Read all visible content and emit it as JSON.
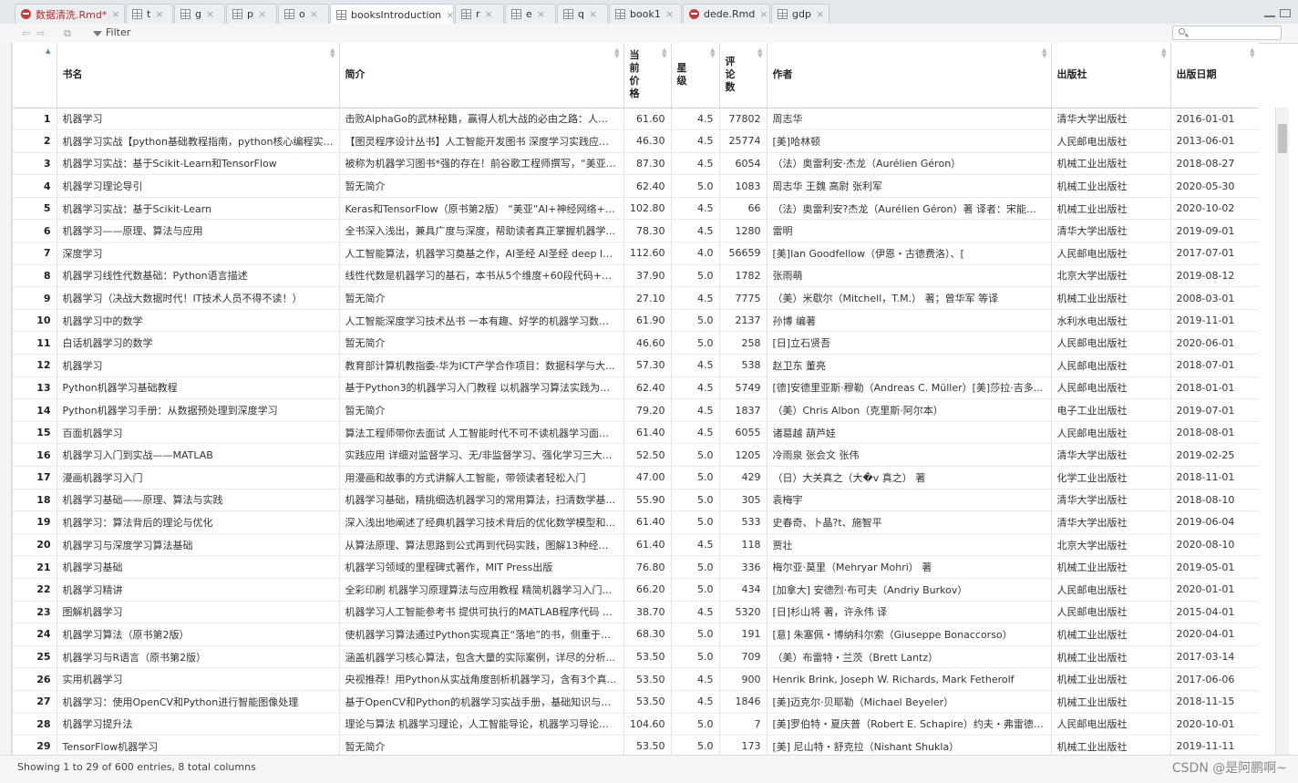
{
  "tabs": [
    {
      "label": "数据清洗.Rmd*",
      "icon": "rmd-icon",
      "modified": true,
      "w": 121
    },
    {
      "label": "t",
      "icon": "table-icon",
      "w": 52
    },
    {
      "label": "g",
      "icon": "table-icon",
      "w": 56
    },
    {
      "label": "p",
      "icon": "table-icon",
      "w": 56
    },
    {
      "label": "o",
      "icon": "table-icon",
      "w": 56
    },
    {
      "label": "booksIntroduction",
      "icon": "table-icon",
      "active": true,
      "w": 136
    },
    {
      "label": "r",
      "icon": "table-icon",
      "w": 54
    },
    {
      "label": "e",
      "icon": "table-icon",
      "w": 56
    },
    {
      "label": "q",
      "icon": "table-icon",
      "w": 56
    },
    {
      "label": "book1",
      "icon": "table-icon",
      "w": 80
    },
    {
      "label": "dede.Rmd",
      "icon": "rmd-icon",
      "w": 96
    },
    {
      "label": "gdp",
      "icon": "table-icon",
      "w": 64
    }
  ],
  "toolbar": {
    "filter_label": "Filter"
  },
  "columns": [
    {
      "label": "",
      "w": 48,
      "cls": "idx"
    },
    {
      "label": "书名",
      "w": 310
    },
    {
      "label": "简介",
      "w": 312
    },
    {
      "label": "当\n前\n价\n格",
      "w": 52,
      "cls": "num"
    },
    {
      "label": "星\n级",
      "w": 53,
      "cls": "num"
    },
    {
      "label": "评\n论\n数",
      "w": 52,
      "cls": "num"
    },
    {
      "label": "作者",
      "w": 312
    },
    {
      "label": "出版社",
      "w": 131
    },
    {
      "label": "出版日期",
      "w": 97
    }
  ],
  "rows": [
    [
      "1",
      "机器学习",
      "击败AlphaGo的武林秘籍，赢得人机大战的必由之路：人工...",
      "61.60",
      "4.5",
      "77802",
      "周志华",
      "清华大学出版社",
      "2016-01-01"
    ],
    [
      "2",
      "机器学习实战【python基础教程指南，python核心编程实例...",
      "【图灵程序设计丛书】人工智能开发图书 深度学习实践应用...",
      "46.30",
      "4.5",
      "25774",
      "[美]哈林顿",
      "人民邮电出版社",
      "2013-06-01"
    ],
    [
      "3",
      "机器学习实战：基于Scikit-Learn和TensorFlow",
      "被称为机器学习图书*强的存在！前谷歌工程师撰写，“美亚”...",
      "87.30",
      "4.5",
      "6054",
      "（法）奥雷利安·杰龙（Aurélien Géron）",
      "机械工业出版社",
      "2018-08-27"
    ],
    [
      "4",
      "机器学习理论导引",
      "暂无简介",
      "62.40",
      "5.0",
      "1083",
      "周志华 王魏 高尉 张利军",
      "机械工业出版社",
      "2020-05-30"
    ],
    [
      "5",
      "机器学习实战：基于Scikit-Learn",
      "Keras和TensorFlow（原书第2版） “美亚”AI+神经网络+CV三...",
      "102.80",
      "4.5",
      "66",
      "（法）奥雷利安?杰龙（Aurélien Géron）著 译者：宋能辉 ...",
      "机械工业出版社",
      "2020-10-02"
    ],
    [
      "6",
      "机器学习——原理、算法与应用",
      "全书深入浅出，兼具广度与深度，帮助读者真正掌握机器学...",
      "78.30",
      "4.5",
      "1280",
      "雷明",
      "清华大学出版社",
      "2019-09-01"
    ],
    [
      "7",
      "深度学习",
      "人工智能算法，机器学习奠基之作，AI圣经 AI圣经 deep lear...",
      "112.60",
      "4.0",
      "56659",
      "[美]Ian Goodfellow（伊恩・古德费洛）、[",
      "人民邮电出版社",
      "2017-07-01"
    ],
    [
      "8",
      "机器学习线性代数基础：Python语言描述",
      "线性代数是机器学习的基石，本书从5个维度+60段代码+53...",
      "37.90",
      "5.0",
      "1782",
      "张雨萌",
      "北京大学出版社",
      "2019-08-12"
    ],
    [
      "9",
      "机器学习（决战大数据时代！IT技术人员不得不读！）",
      "暂无简介",
      "27.10",
      "4.5",
      "7775",
      "（美）米歇尔（Mitchell，T.M.） 著；曾华军 等译",
      "机械工业出版社",
      "2008-03-01"
    ],
    [
      "10",
      "机器学习中的数学",
      "人工智能深度学习技术丛书 一本有趣、好学的机器学习数学...",
      "61.90",
      "5.0",
      "2137",
      "孙博 编著",
      "水利水电出版社",
      "2019-11-01"
    ],
    [
      "11",
      "白话机器学习的数学",
      "暂无简介",
      "46.60",
      "5.0",
      "258",
      "[日]立石贤吾",
      "人民邮电出版社",
      "2020-06-01"
    ],
    [
      "12",
      "机器学习",
      "教育部计算机教指委-华为ICT产学合作项目：数据科学与大...",
      "57.30",
      "4.5",
      "538",
      "赵卫东 董亮",
      "人民邮电出版社",
      "2018-07-01"
    ],
    [
      "13",
      "Python机器学习基础教程",
      "基于Python3的机器学习入门教程 以机器学习算法实践为重...",
      "62.40",
      "4.5",
      "5749",
      "[德]安德里亚斯·穆勒（Andreas C. Müller）[美]莎拉·吉多...",
      "人民邮电出版社",
      "2018-01-01"
    ],
    [
      "14",
      "Python机器学习手册：从数据预处理到深度学习",
      "暂无简介",
      "79.20",
      "4.5",
      "1837",
      "（美）Chris Albon（克里斯·阿尔本）",
      "电子工业出版社",
      "2019-07-01"
    ],
    [
      "15",
      "百面机器学习",
      "算法工程师带你去面试 人工智能时代不可不读机器学习面试...",
      "61.40",
      "4.5",
      "6055",
      "诸葛越 葫芦娃",
      "人民邮电出版社",
      "2018-08-01"
    ],
    [
      "16",
      "机器学习入门到实战——MATLAB",
      "实践应用 详细对监督学习、无/非监督学习、强化学习三大...",
      "52.50",
      "5.0",
      "1205",
      "冷雨泉 张会文 张伟",
      "清华大学出版社",
      "2019-02-25"
    ],
    [
      "17",
      "漫画机器学习入门",
      "用漫画和故事的方式讲解人工智能，带领读者轻松入门",
      "47.00",
      "5.0",
      "429",
      "（日）大关真之（大�v 真之） 著",
      "化学工业出版社",
      "2018-11-01"
    ],
    [
      "18",
      "机器学习基础——原理、算法与实践",
      "机器学习基础，精挑细选机器学习的常用算法，扫清数学基...",
      "55.90",
      "5.0",
      "305",
      "袁梅宇",
      "清华大学出版社",
      "2018-08-10"
    ],
    [
      "19",
      "机器学习：算法背后的理论与优化",
      "深入浅出地阐述了经典机器学习技术背后的优化数学模型和...",
      "61.40",
      "5.0",
      "533",
      "史春奇、卜晶?t、施智平",
      "清华大学出版社",
      "2019-06-04"
    ],
    [
      "20",
      "机器学习与深度学习算法基础",
      "从算法原理、算法思路到公式再到代码实践，图解13种经典...",
      "61.40",
      "4.5",
      "118",
      "贾壮",
      "北京大学出版社",
      "2020-08-10"
    ],
    [
      "21",
      "机器学习基础",
      "机器学习领域的里程碑式著作，MIT Press出版",
      "76.80",
      "5.0",
      "336",
      "梅尔亚·莫里（Mehryar Mohri） 著",
      "机械工业出版社",
      "2019-05-01"
    ],
    [
      "22",
      "机器学习精讲",
      "全彩印刷 机器学习原理算法与应用教程 精简机器学习入门...",
      "66.20",
      "5.0",
      "434",
      "[加拿大] 安德烈·布可夫（Andriy Burkov）",
      "人民邮电出版社",
      "2020-01-01"
    ],
    [
      "23",
      "图解机器学习",
      "机器学习人工智能参考书 提供可执行的MATLAB程序代码 覆...",
      "38.70",
      "4.5",
      "5320",
      "[日]杉山将 著，许永伟 译",
      "人民邮电出版社",
      "2015-04-01"
    ],
    [
      "24",
      "机器学习算法（原书第2版）",
      "使机器学习算法通过Python实现真正“落地”的书，侧重于介...",
      "68.30",
      "5.0",
      "191",
      "[意] 朱塞佩・博纳科尔索（Giuseppe Bonaccorso）",
      "机械工业出版社",
      "2020-04-01"
    ],
    [
      "25",
      "机器学习与R语言（原书第2版）",
      "涵盖机器学习核心算法，包含大量的实际案例，详尽的分析...",
      "53.50",
      "5.0",
      "709",
      "（美）布雷特・兰茨（Brett Lantz）",
      "机械工业出版社",
      "2017-03-14"
    ],
    [
      "26",
      "实用机器学习",
      "央视推荐！用Python从实战角度剖析机器学习，含有3个真...",
      "53.50",
      "4.5",
      "900",
      "Henrik Brink, Joseph W. Richards, Mark Fetherolf",
      "机械工业出版社",
      "2017-06-06"
    ],
    [
      "27",
      "机器学习：使用OpenCV和Python进行智能图像处理",
      "基于OpenCV和Python的机器学习实战手册，基础知识与具...",
      "53.50",
      "4.5",
      "1846",
      "[美]迈克尔·贝耶勒（Michael Beyeler）",
      "机械工业出版社",
      "2018-11-15"
    ],
    [
      "28",
      "机器学习提升法",
      "理论与算法 机器学习理论，人工智能导论，机器学习导论和...",
      "104.60",
      "5.0",
      "7",
      "[美]罗伯特・夏庆普（Robert E. Schapire）约夫・弗雷德（Yo",
      "人民邮电出版社",
      "2020-10-01"
    ],
    [
      "29",
      "TensorFlow机器学习",
      "暂无简介",
      "53.50",
      "5.0",
      "173",
      "[美] 尼山特・舒克拉（Nishant Shukla）",
      "机械工业出版社",
      "2019-11-11"
    ]
  ],
  "status": {
    "text": "Showing 1 to 29 of 600 entries, 8 total columns"
  },
  "watermark": "CSDN @是阿鹏啊~"
}
